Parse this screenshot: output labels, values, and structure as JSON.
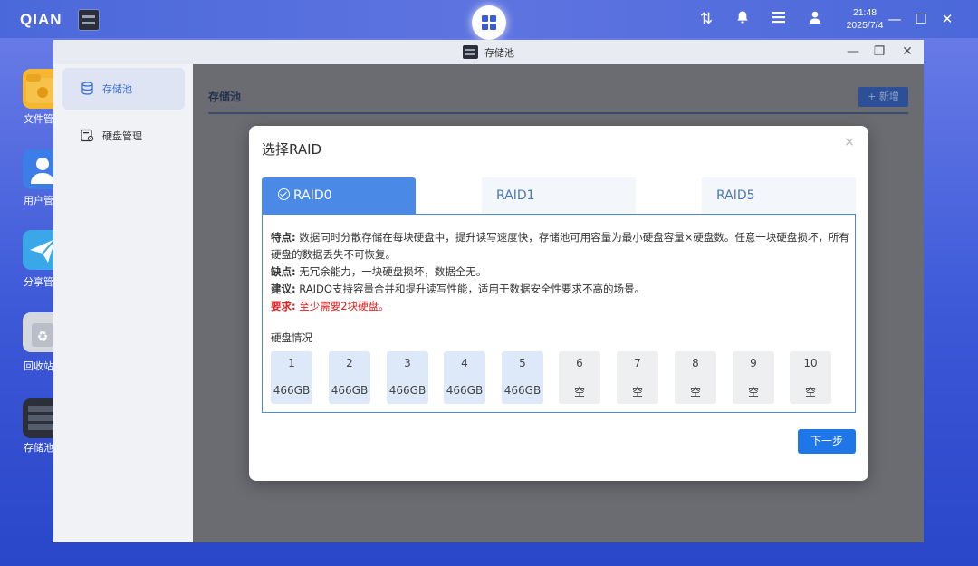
{
  "taskbar": {
    "logo": "QIAN",
    "clock_time": "21:48",
    "clock_date": "2025/7/4",
    "icons": [
      "transfer-icon",
      "notification-icon",
      "menu-list-icon",
      "user-icon"
    ]
  },
  "desktop": {
    "icons": [
      {
        "label": "文件管",
        "icon": "folder-icon",
        "color": "#f5b731"
      },
      {
        "label": "用户管",
        "icon": "user-management-icon",
        "color": "#3d7de8"
      },
      {
        "label": "分享管",
        "icon": "share-icon",
        "color": "#39a7e8"
      },
      {
        "label": "回收站",
        "icon": "recycle-bin-icon",
        "color": "#d5d8de"
      },
      {
        "label": "存储池",
        "icon": "storage-pool-icon",
        "color": "#2b2f3a"
      }
    ]
  },
  "window": {
    "title": "存储池",
    "sidebar": [
      {
        "label": "存储池",
        "icon": "database-icon",
        "active": true
      },
      {
        "label": "硬盘管理",
        "icon": "disk-management-icon",
        "active": false
      }
    ],
    "main_title": "存储池",
    "new_button": "+ 新增"
  },
  "dialog": {
    "title": "选择RAID",
    "close_glyph": "×",
    "tabs": [
      {
        "label": "RAID0",
        "active": true
      },
      {
        "label": "RAID1",
        "active": false
      },
      {
        "label": "RAID5",
        "active": false
      }
    ],
    "features_label": "特点:",
    "features_text": "数据同时分散存储在每块硬盘中，提升读写速度快，存储池可用容量为最小硬盘容量×硬盘数。任意一块硬盘损坏，所有硬盘的数据丢失不可恢复。",
    "cons_label": "缺点:",
    "cons_text": "无冗余能力，一块硬盘损坏，数据全无。",
    "advice_label": "建议:",
    "advice_text": "RAIDO支持容量合并和提升读写性能，适用于数据安全性要求不高的场景。",
    "requirement_label": "要求:",
    "requirement_text": "至少需要2块硬盘。",
    "disk_section_title": "硬盘情况",
    "disks": [
      {
        "num": "1",
        "cap": "466GB",
        "used": true
      },
      {
        "num": "2",
        "cap": "466GB",
        "used": true
      },
      {
        "num": "3",
        "cap": "466GB",
        "used": true
      },
      {
        "num": "4",
        "cap": "466GB",
        "used": true
      },
      {
        "num": "5",
        "cap": "466GB",
        "used": true
      },
      {
        "num": "6",
        "cap": "空",
        "used": false
      },
      {
        "num": "7",
        "cap": "空",
        "used": false
      },
      {
        "num": "8",
        "cap": "空",
        "used": false
      },
      {
        "num": "9",
        "cap": "空",
        "used": false
      },
      {
        "num": "10",
        "cap": "空",
        "used": false
      }
    ],
    "next_button": "下一步"
  }
}
